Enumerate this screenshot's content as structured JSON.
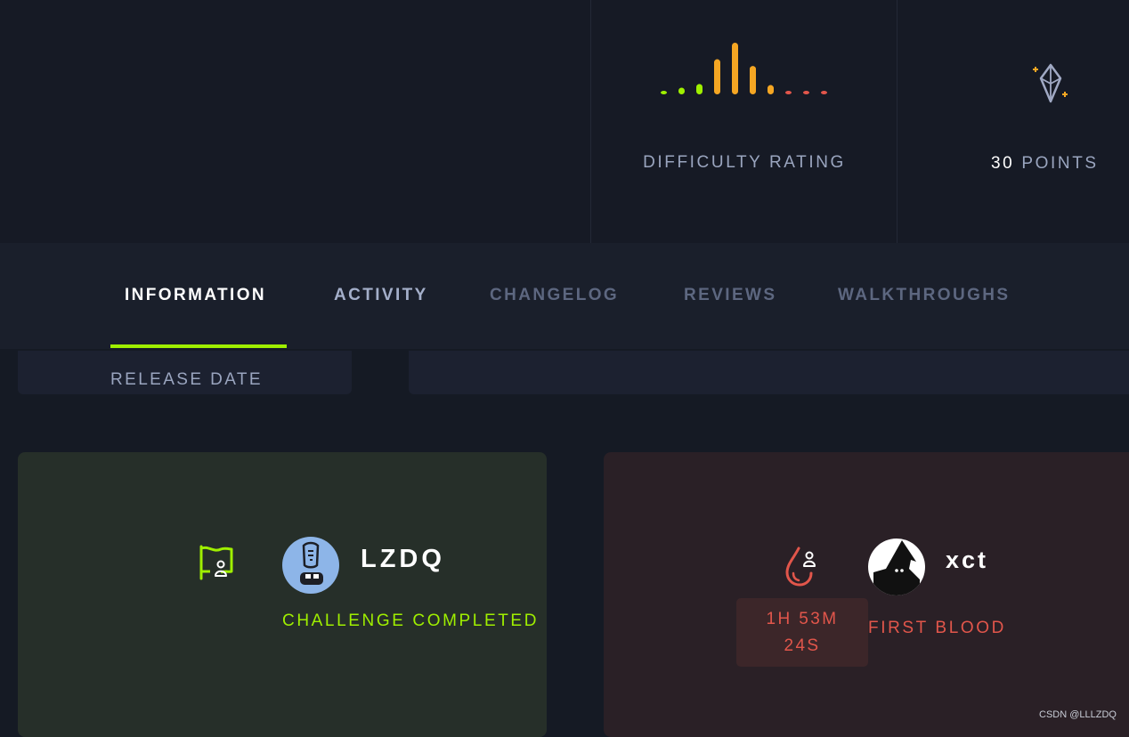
{
  "difficulty": {
    "label": "DIFFICULTY RATING",
    "bars": [
      0.05,
      0.13,
      0.2,
      0.68,
      1.0,
      0.55,
      0.18,
      0.05,
      0.03,
      0.03
    ],
    "bar_colors": [
      "#9fef00",
      "#9fef00",
      "#9fef00",
      "#f5a623",
      "#f5a623",
      "#f5a623",
      "#f5a623",
      "#e2564b",
      "#e2564b",
      "#e2564b"
    ]
  },
  "points": {
    "value": "30",
    "label": "POINTS",
    "icon": "diamond-icon"
  },
  "tabs": [
    {
      "label": "INFORMATION",
      "active": true
    },
    {
      "label": "ACTIVITY"
    },
    {
      "label": "CHANGELOG"
    },
    {
      "label": "REVIEWS"
    },
    {
      "label": "WALKTHROUGHS"
    }
  ],
  "release": {
    "label": "RELEASE DATE"
  },
  "completion": {
    "user": "LZDQ",
    "status": "CHALLENGE COMPLETED",
    "icon": "flag-user-icon"
  },
  "first_blood": {
    "user": "xct",
    "time_line1": "1H 53M",
    "time_line2": "24S",
    "label": "FIRST BLOOD",
    "icon": "blood-drop-icon"
  },
  "watermark": "CSDN @LLLZDQ",
  "colors": {
    "accent_green": "#9fef00",
    "accent_orange": "#f5a623",
    "accent_red": "#e2564b",
    "background": "#151a24"
  }
}
